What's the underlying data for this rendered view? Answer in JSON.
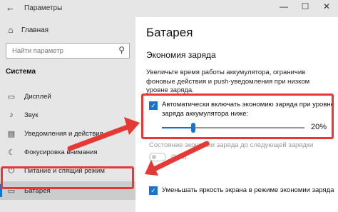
{
  "window": {
    "back_glyph": "←",
    "title": "Параметры",
    "minimize_glyph": "—",
    "maximize_glyph": "☐",
    "close_glyph": "✕"
  },
  "sidebar": {
    "home_label": "Главная",
    "search_placeholder": "Найти параметр",
    "section_title": "Система",
    "items": [
      {
        "label": "Дисплей",
        "icon": "display-icon"
      },
      {
        "label": "Звук",
        "icon": "speaker-icon"
      },
      {
        "label": "Уведомления и действия",
        "icon": "notification-icon"
      },
      {
        "label": "Фокусировка внимания",
        "icon": "moon-icon"
      },
      {
        "label": "Питание и спящий режим",
        "icon": "power-icon"
      },
      {
        "label": "Батарея",
        "icon": "battery-icon",
        "active": true
      }
    ]
  },
  "main": {
    "page_title": "Батарея",
    "section_title": "Экономия заряда",
    "description": "Увеличьте время работы аккумулятора, ограничив фоновые действия и push-уведомления при низком уровне заряда.",
    "auto_enable": {
      "checked": true,
      "label": "Автоматически включать экономию заряда при уровне заряда аккумулятора ниже:"
    },
    "slider": {
      "value_percent": 20,
      "value_label": "20%"
    },
    "state_label": "Состояние экономии заряда до следующей зарядки",
    "toggle": {
      "on": false,
      "label": "Откл."
    },
    "brightness": {
      "checked": true,
      "label": "Уменьшать яркость экрана в режиме экономии заряда"
    }
  },
  "colors": {
    "accent": "#1a73c9",
    "highlight": "#e53935",
    "sidebar_bg": "#e6e6e6"
  }
}
